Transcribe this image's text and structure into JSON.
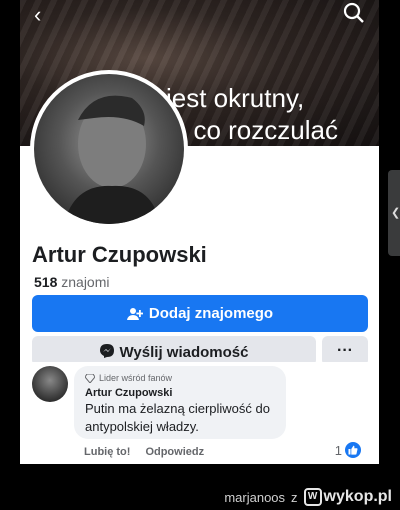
{
  "cover": {
    "text": "jest okrutny,\nię co rozczulać"
  },
  "profile": {
    "name": "Artur Czupowski",
    "friends_count": "518",
    "friends_label": "znajomi"
  },
  "buttons": {
    "add_friend": "Dodaj znajomego",
    "message": "Wyślij wiadomość",
    "more": "···"
  },
  "comment": {
    "badge": "Lider wśród fanów",
    "author": "Artur Czupowski",
    "text": "Putin ma żelazną cierpliwość do antypolskiej władzy.",
    "like_action": "Lubię to!",
    "reply_action": "Odpowiedz",
    "reaction_count": "1"
  },
  "footer": {
    "user": "marjanoos",
    "separator": "z",
    "site": "wykop.pl"
  },
  "colors": {
    "accent": "#1877f2",
    "secondary_button": "#e4e6eb"
  }
}
